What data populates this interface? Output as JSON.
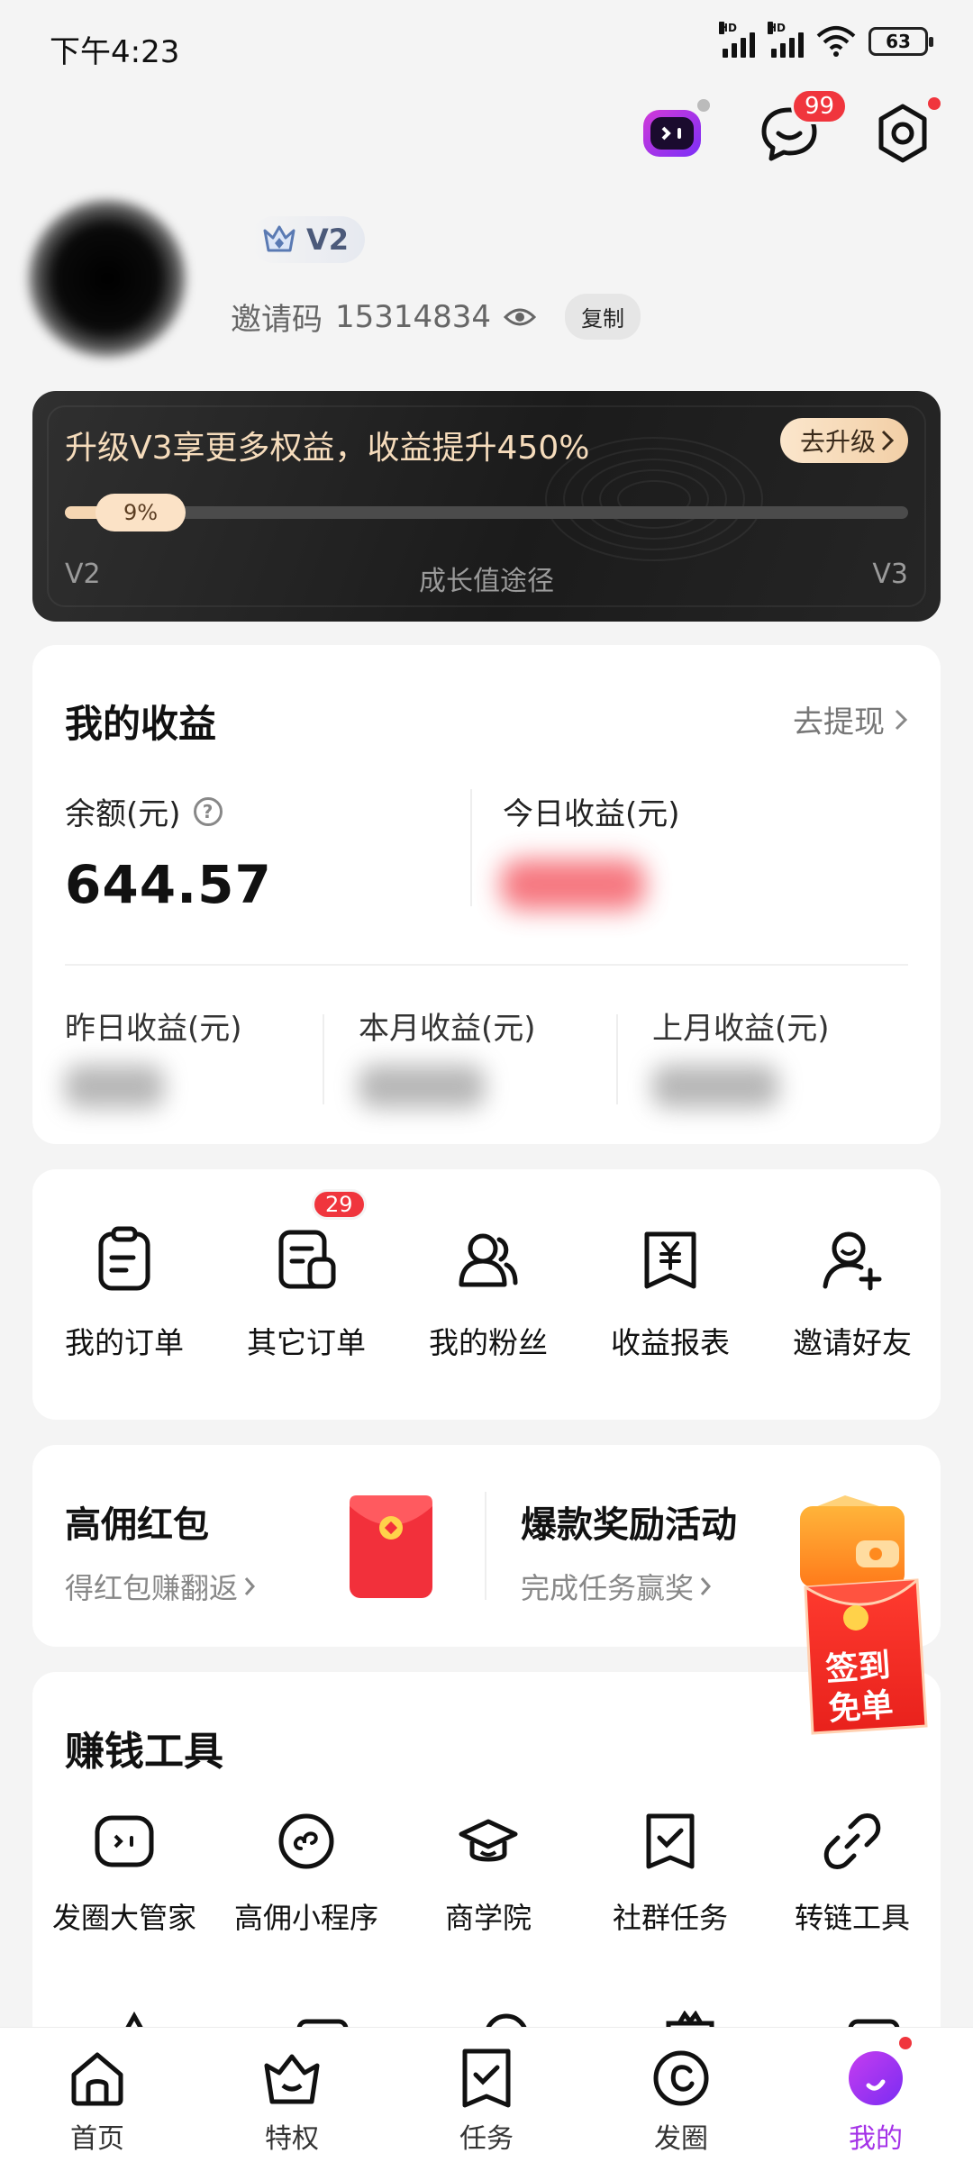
{
  "status_bar": {
    "time": "下午4:23",
    "network_tag": "HD",
    "battery": "63"
  },
  "header": {
    "message_badge": "99"
  },
  "profile": {
    "level": "V2",
    "invite_label": "邀请码",
    "invite_code": "15314834",
    "copy_label": "复制"
  },
  "upgrade": {
    "title": "升级V3享更多权益，收益提升450%",
    "button": "去升级",
    "progress_text": "9%",
    "progress": 0.09,
    "from_level": "V2",
    "path_label": "成长值途径",
    "to_level": "V3"
  },
  "earnings": {
    "title": "我的收益",
    "withdraw": "去提现",
    "balance_label": "余额(元)",
    "balance": "644.57",
    "today_label": "今日收益(元)",
    "yesterday_label": "昨日收益(元)",
    "month_label": "本月收益(元)",
    "last_month_label": "上月收益(元)"
  },
  "quick_actions": [
    {
      "label": "我的订单",
      "icon": "order-icon"
    },
    {
      "label": "其它订单",
      "icon": "other-orders-icon",
      "badge": "29"
    },
    {
      "label": "我的粉丝",
      "icon": "fans-icon"
    },
    {
      "label": "收益报表",
      "icon": "yuan-report-icon"
    },
    {
      "label": "邀请好友",
      "icon": "invite-friend-icon"
    }
  ],
  "promo": {
    "left_title": "高佣红包",
    "left_sub": "得红包赚翻返",
    "right_title": "爆款奖励活动",
    "right_sub": "完成任务赢奖"
  },
  "floating": {
    "line1": "签到",
    "line2": "免单"
  },
  "tools": {
    "title": "赚钱工具",
    "items": [
      {
        "label": "发圈大管家",
        "icon": "robot-icon"
      },
      {
        "label": "高佣小程序",
        "icon": "mini-program-icon"
      },
      {
        "label": "商学院",
        "icon": "graduation-cap-icon"
      },
      {
        "label": "社群任务",
        "icon": "task-check-icon"
      },
      {
        "label": "转链工具",
        "icon": "link-icon"
      }
    ]
  },
  "nav": [
    {
      "label": "首页",
      "icon": "home-icon"
    },
    {
      "label": "特权",
      "icon": "crown-bag-icon"
    },
    {
      "label": "任务",
      "icon": "task-icon"
    },
    {
      "label": "发圈",
      "icon": "circle-icon"
    },
    {
      "label": "我的",
      "icon": "profile-icon",
      "active": true
    }
  ],
  "colors": {
    "accent": "#a533e8",
    "badge": "#f0353d",
    "gold": "#f5d6b2"
  }
}
